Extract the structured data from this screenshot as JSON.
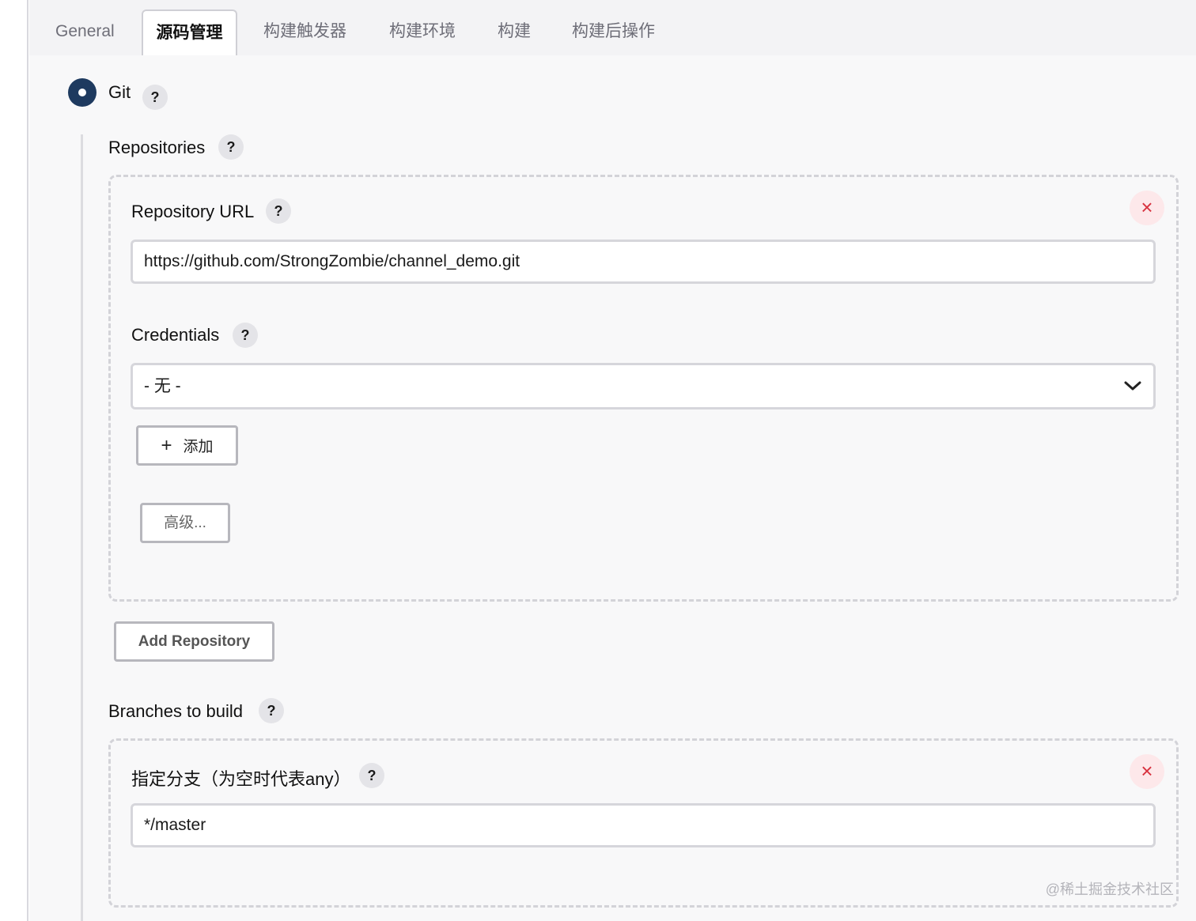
{
  "tabs": [
    {
      "label": "General",
      "active": false
    },
    {
      "label": "源码管理",
      "active": true
    },
    {
      "label": "构建触发器",
      "active": false
    },
    {
      "label": "构建环境",
      "active": false
    },
    {
      "label": "构建",
      "active": false
    },
    {
      "label": "构建后操作",
      "active": false
    }
  ],
  "scm": {
    "git_label": "Git",
    "help_glyph": "?",
    "repositories_label": "Repositories",
    "repository": {
      "url_label": "Repository URL",
      "url_value": "https://github.com/StrongZombie/channel_demo.git",
      "credentials_label": "Credentials",
      "credentials_value": "- 无 -",
      "add_label": "添加",
      "add_icon": "+",
      "advanced_label": "高级...",
      "close_icon": "×"
    },
    "add_repository_label": "Add Repository",
    "branches_label": "Branches to build",
    "branch": {
      "spec_label": "指定分支（为空时代表any）",
      "spec_value": "*/master",
      "close_icon": "×"
    }
  },
  "watermark": "@稀土掘金技术社区",
  "colors": {
    "radio": "#1e3a5f",
    "close_bg": "#fde8ea",
    "close_fg": "#d8323f",
    "page_bg": "#f8f8f9"
  }
}
